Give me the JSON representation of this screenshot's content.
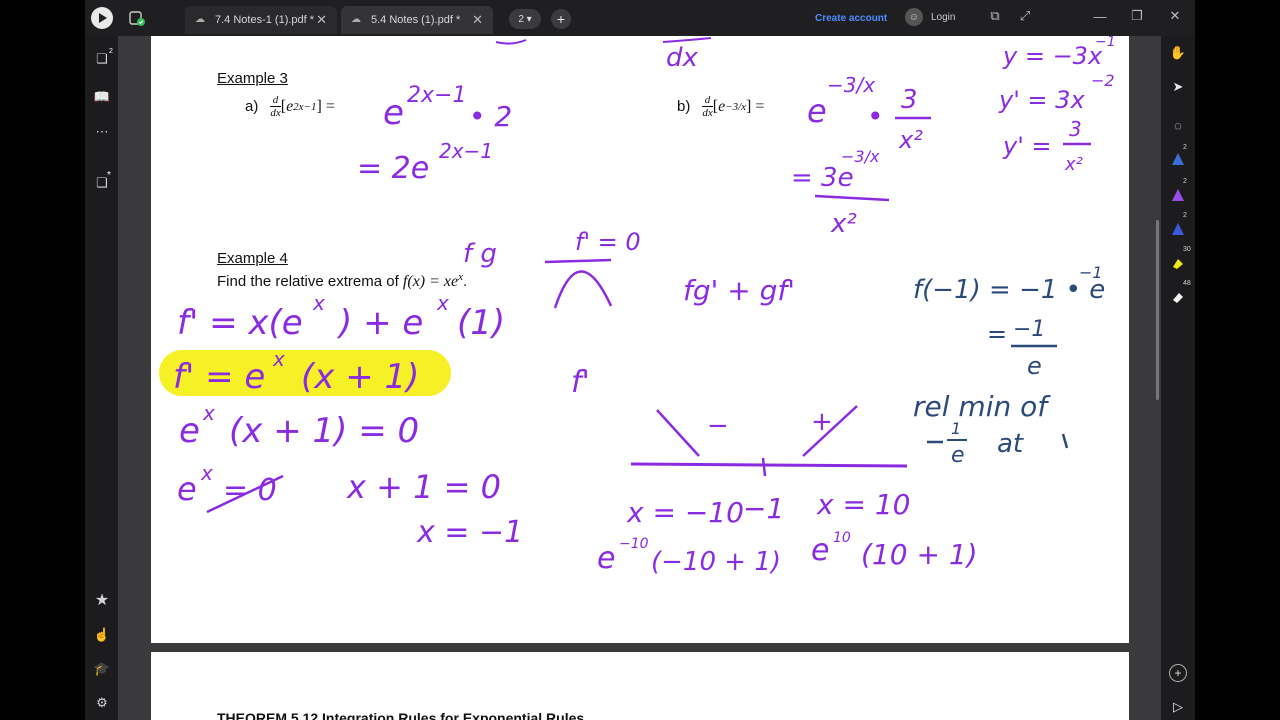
{
  "tabs": [
    {
      "label": "7.4 Notes-1 (1).pdf *"
    },
    {
      "label": "5.4 Notes (1).pdf *"
    }
  ],
  "toolbar": {
    "page_count": "2",
    "new_tab": "+",
    "create_account": "Create account",
    "login": "Login"
  },
  "left_sidebar": {
    "pages_badge": "2",
    "bookmark_badge": "*"
  },
  "right_sidebar": {
    "tool_counts": [
      "2",
      "2",
      "2",
      "30",
      "48"
    ]
  },
  "document": {
    "example3": {
      "title": "Example 3",
      "part_a_label": "a)",
      "part_a_open": "[",
      "part_a_expr": "e",
      "part_a_exp": "2x−1",
      "part_a_close": "] =",
      "part_b_label": "b)",
      "part_b_expr": "e",
      "part_b_exp": "−3/x",
      "part_b_close": "] =",
      "deriv_num": "d",
      "deriv_den": "dx"
    },
    "example4": {
      "title": "Example 4",
      "prompt": "Find the relative extrema of ",
      "function": "f(x) = xe",
      "function_exp": "x",
      "period": "."
    },
    "next_page_heading": "THEOREM 5.12 Integration Rules for Exponential Rules"
  },
  "handwriting": {
    "top_partial_1": "dx",
    "a_step1": "e",
    "a_step1_exp": "2x−1",
    "a_step1_times": "• 2",
    "a_step2": "= 2e",
    "a_step2_exp": "2x−1",
    "b_step1": "e",
    "b_step1_exp": "−3/x",
    "b_step1_times": "•",
    "b_frac_num": "3",
    "b_frac_den": "x²",
    "b_result_num": "= 3e",
    "b_result_exp": "−3/x",
    "b_result_den": "x²",
    "side_y1": "y = −3x",
    "side_y1_exp": "−1",
    "side_y2": "y' = 3x",
    "side_y2_exp": "−2",
    "side_y3": "y' =",
    "side_y3_num": "3",
    "side_y3_den": "x²",
    "fg": "f g",
    "fprime_zero": "f' = 0",
    "product_rule": "fg' + gf'",
    "f_neg1": "f(−1) = −1 • e",
    "f_neg1_exp": "−1",
    "f_neg1_eq": "=",
    "f_neg1_num": "−1",
    "f_neg1_den": "e",
    "line1": "f' = x(e",
    "line1_exp": "x",
    "line1_rest": ") + e",
    "line1_exp2": "x",
    "line1_end": "(1)",
    "line2": "f' = e",
    "line2_exp": "x",
    "line2_rest": "(x + 1)",
    "line3": "e",
    "line3_exp": "x",
    "line3_rest": "(x + 1) = 0",
    "line4": "e",
    "line4_exp": "x",
    "line4_rest": " = 0",
    "line4_b": "x + 1 = 0",
    "line5": "x = −1",
    "fprime_label": "f'",
    "sign_minus": "−",
    "sign_plus": "+",
    "rel_min": "rel min of",
    "rel_min_val_num": "1",
    "rel_min_val_den": "e",
    "rel_min_at": "at",
    "tick_left": "x = −10",
    "tick_mid": "−1",
    "tick_right": "x = 10",
    "eval_left": "e",
    "eval_left_exp": "−10",
    "eval_left_rest": "(−10 + 1)",
    "eval_right": "e",
    "eval_right_exp": "10",
    "eval_right_rest": "(10 + 1)"
  },
  "colors": {
    "ink_purple": "#8a2be2",
    "ink_navy": "#2b4a7a",
    "highlight": "#f5ef1a",
    "link_blue": "#4f8cff"
  }
}
